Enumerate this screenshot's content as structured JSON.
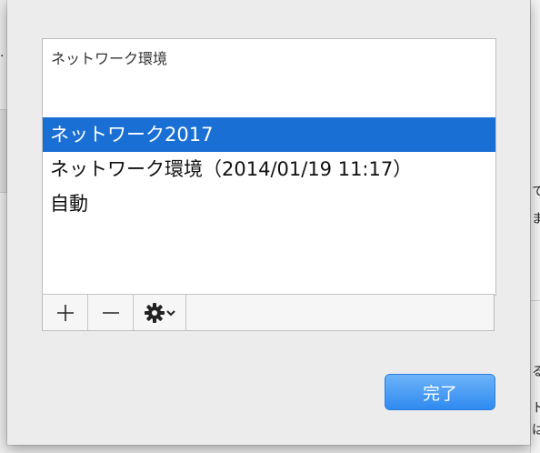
{
  "network_list": {
    "header": "ネットワーク環境",
    "items": [
      {
        "label": "ネットワーク2017",
        "selected": true
      },
      {
        "label": "ネットワーク環境（2014/01/19 11:17）",
        "selected": false
      },
      {
        "label": "自動",
        "selected": false
      }
    ]
  },
  "toolbar": {
    "add_icon": "plus-icon",
    "remove_icon": "minus-icon",
    "action_icon": "gear-icon",
    "action_menu_icon": "chevron-down-icon"
  },
  "done_button": {
    "label": "完了"
  },
  "background_fragments": {
    "right_1": "て",
    "right_2": "ま",
    "right_3": "る",
    "right_4": "ト",
    "right_5": "は",
    "left_1": "."
  },
  "colors": {
    "selection": "#1a6fd4",
    "primary_button": "#2f8af0",
    "sheet_background": "#ececec"
  }
}
